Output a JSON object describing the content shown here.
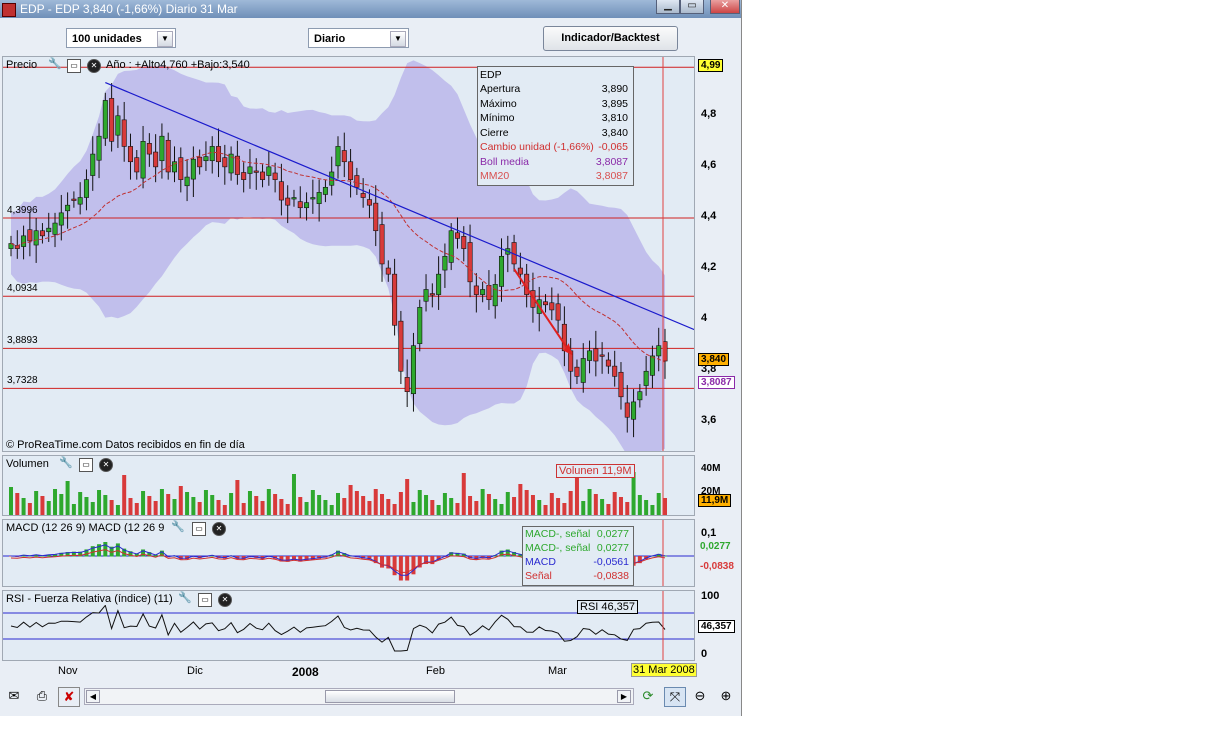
{
  "window": {
    "title": "EDP - EDP    3,840 (-1,66%)    Diario  31 Mar"
  },
  "toolbar": {
    "units": "100 unidades",
    "period": "Diario",
    "indicator_button": "Indicador/Backtest"
  },
  "price_panel": {
    "title": "Precio",
    "year_range": "Año : +Alto4,760 +Bajo:3,540",
    "footer": "© ProReaTime.com  Datos recibidos en fin de día",
    "hlines": [
      {
        "label": "4,3996",
        "value": 4.3996
      },
      {
        "label": "4,0934",
        "value": 4.0934
      },
      {
        "label": "3,8893",
        "value": 3.8893
      },
      {
        "label": "3,7328",
        "value": 3.7328
      }
    ],
    "top_line": 4.99,
    "y_ticks": [
      "4,8",
      "4,6",
      "4,4",
      "4,2",
      "4",
      "3,8",
      "3,6"
    ],
    "y_tick_values": [
      4.8,
      4.6,
      4.4,
      4.2,
      4.0,
      3.8,
      3.6
    ],
    "ylim": [
      3.48,
      5.03
    ],
    "top_tag": "4,99",
    "last_tag": "3,840",
    "boll_tag": "3,8087"
  },
  "info_box": {
    "name": "EDP",
    "rows": [
      {
        "label": "Apertura",
        "value": "3,890"
      },
      {
        "label": "Máximo",
        "value": "3,895"
      },
      {
        "label": "Mínimo",
        "value": "3,810"
      },
      {
        "label": "Cierre",
        "value": "3,840"
      },
      {
        "label": "Cambio unidad (-1,66%)",
        "value": "-0,065"
      },
      {
        "label": "Boll media",
        "value": "3,8087"
      },
      {
        "label": "MM20",
        "value": "3,8087"
      }
    ]
  },
  "volume_panel": {
    "title": "Volumen",
    "label": "Volunen 11,9M",
    "y_ticks": [
      "40M",
      "20M"
    ],
    "last_tag": "11,9M"
  },
  "macd_panel": {
    "title": "MACD (12 26 9) MACD (12 26 9)",
    "rows": [
      {
        "label": "MACD-, señal",
        "value": "0,0277"
      },
      {
        "label": "MACD-, señal",
        "value": "0,0277"
      },
      {
        "label": "MACD",
        "value": "-0,0561"
      },
      {
        "label": "Señal",
        "value": "-0,0838"
      }
    ],
    "y_tick": "0,1",
    "tag_hist": "0,0277",
    "tag_signal": "-0,0838"
  },
  "rsi_panel": {
    "title": "RSI - Fuerza Relativa (índice) (11)",
    "label": "RSI 46,357",
    "y_ticks": [
      "100",
      "0"
    ],
    "last_tag": "46,357"
  },
  "x_axis": {
    "labels": [
      "Nov",
      "Dic",
      "2008",
      "Feb",
      "Mar"
    ],
    "current_date": "31 Mar 2008"
  },
  "colors": {
    "up": "#2ea82e",
    "down": "#d83a3a",
    "band": "#a69ae6",
    "trend": "#1a1acc",
    "tag_yellow": "#ffff33",
    "tag_orange": "#ffb000"
  },
  "chart_data": {
    "type": "candlestick",
    "title": "EDP",
    "dates_note": "Daily bars from late Oct 2007 to 31 Mar 2008",
    "x_axis_labels": [
      "Nov",
      "Dic",
      "2008",
      "Feb",
      "Mar"
    ],
    "ylim": [
      3.48,
      5.03
    ],
    "closes": [
      4.3,
      4.28,
      4.33,
      4.31,
      4.35,
      4.33,
      4.36,
      4.38,
      4.42,
      4.45,
      4.47,
      4.48,
      4.55,
      4.65,
      4.72,
      4.86,
      4.7,
      4.8,
      4.68,
      4.62,
      4.58,
      4.7,
      4.65,
      4.6,
      4.72,
      4.58,
      4.62,
      4.55,
      4.56,
      4.63,
      4.6,
      4.64,
      4.68,
      4.62,
      4.6,
      4.65,
      4.57,
      4.55,
      4.6,
      4.58,
      4.55,
      4.6,
      4.55,
      4.47,
      4.45,
      4.48,
      4.44,
      4.46,
      4.48,
      4.5,
      4.52,
      4.58,
      4.68,
      4.62,
      4.55,
      4.52,
      4.48,
      4.45,
      4.35,
      4.22,
      4.18,
      3.98,
      3.8,
      3.72,
      3.9,
      4.05,
      4.12,
      4.1,
      4.18,
      4.25,
      4.35,
      4.32,
      4.28,
      4.15,
      4.1,
      4.12,
      4.08,
      4.14,
      4.25,
      4.28,
      4.22,
      4.18,
      4.1,
      4.05,
      4.08,
      4.06,
      4.04,
      4.0,
      3.88,
      3.8,
      3.78,
      3.85,
      3.88,
      3.84,
      3.86,
      3.82,
      3.78,
      3.7,
      3.62,
      3.68,
      3.72,
      3.8,
      3.86,
      3.9,
      3.84
    ]
  }
}
